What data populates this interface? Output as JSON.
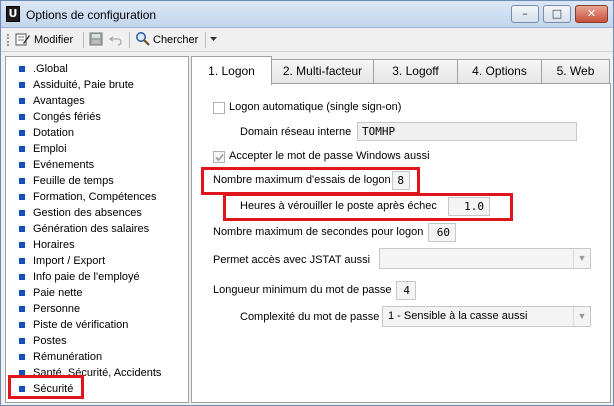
{
  "window": {
    "title": "Options de configuration",
    "app_icon_glyph": "U",
    "buttons": {
      "minimize": "–",
      "maximize": "□",
      "close": "✕"
    }
  },
  "toolbar": {
    "modify_label": "Modifier",
    "search_label": "Chercher"
  },
  "sidebar": {
    "items": [
      {
        "label": ".Global"
      },
      {
        "label": "Assiduité, Paie brute"
      },
      {
        "label": "Avantages"
      },
      {
        "label": "Congés fériés"
      },
      {
        "label": "Dotation"
      },
      {
        "label": "Emploi"
      },
      {
        "label": "Evénements"
      },
      {
        "label": "Feuille de temps"
      },
      {
        "label": "Formation, Compétences"
      },
      {
        "label": "Gestion des absences"
      },
      {
        "label": "Génération des salaires"
      },
      {
        "label": "Horaires"
      },
      {
        "label": "Import / Export"
      },
      {
        "label": "Info paie de l'employé"
      },
      {
        "label": "Paie nette"
      },
      {
        "label": "Personne"
      },
      {
        "label": "Piste de vérification"
      },
      {
        "label": "Postes"
      },
      {
        "label": "Rémunération"
      },
      {
        "label": "Santé, Sécurité, Accidents"
      },
      {
        "label": "Sécurité"
      }
    ],
    "selected": "Sécurité"
  },
  "tabs": [
    {
      "label": "1. Logon",
      "active": true
    },
    {
      "label": "2. Multi-facteur"
    },
    {
      "label": "3. Logoff"
    },
    {
      "label": "4. Options"
    },
    {
      "label": "5. Web"
    }
  ],
  "logon": {
    "auto_logon_label": "Logon automatique (single sign-on)",
    "auto_logon_checked": false,
    "domain_label": "Domain réseau interne",
    "domain_value": "TOMHP",
    "accept_windows_pwd_label": "Accepter le mot de passe Windows aussi",
    "accept_windows_pwd_checked": true,
    "max_attempts_label": "Nombre maximum d'essais de logon",
    "max_attempts_value": "8",
    "lock_hours_label": "Heures à vérouiller le poste après échec",
    "lock_hours_value": "1.0",
    "max_seconds_label": "Nombre maximum de secondes pour logon",
    "max_seconds_value": "60",
    "jstat_access_label": "Permet accès avec JSTAT aussi",
    "jstat_access_value": "",
    "min_pwd_length_label": "Longueur minimum du mot de passe",
    "min_pwd_length_value": "4",
    "pwd_complexity_label": "Complexité du mot de passe",
    "pwd_complexity_value": "1 - Sensible à la casse aussi"
  },
  "colors": {
    "highlight": "#e0141c",
    "bullet": "#1450b8"
  }
}
